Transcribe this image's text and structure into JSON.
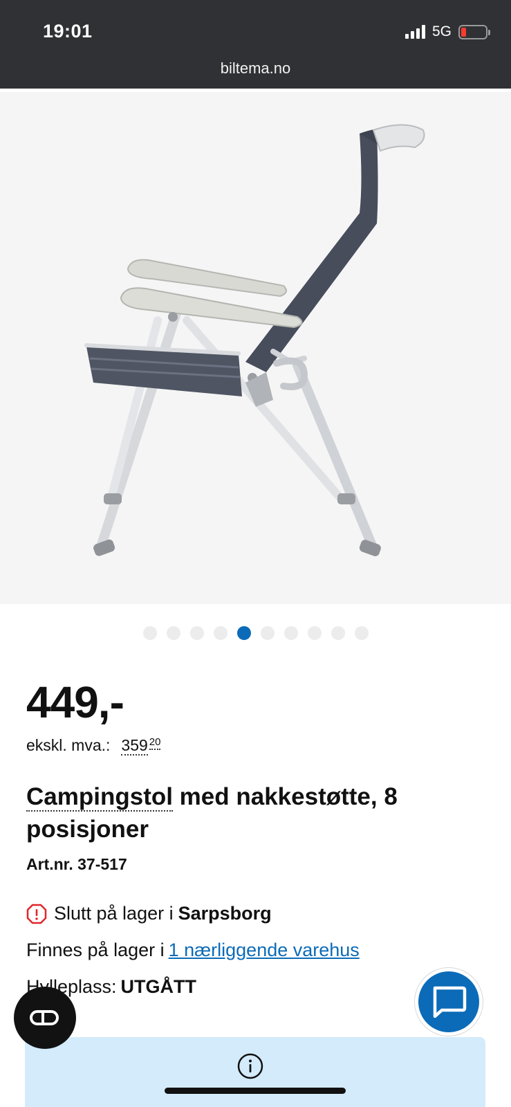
{
  "status_bar": {
    "time": "19:01",
    "network": "5G",
    "battery_color": "#ff3b30"
  },
  "browser": {
    "url": "biltema.no"
  },
  "gallery": {
    "image_icon": "folding-camping-chair-image",
    "total_images": 10,
    "active_index": 4,
    "active_dot_color": "#0b6bb8"
  },
  "product": {
    "price": "449,-",
    "ex_vat_label": "ekskl. mva.:",
    "ex_vat_whole": "359",
    "ex_vat_cents": "20",
    "title_link": "Campingstol",
    "title_rest": " med nakkestøtte, 8 posisjoner",
    "article_number": "Art.nr. 37-517"
  },
  "stock": {
    "out_of_stock_prefix": "Slutt på lager i",
    "store_name": "Sarpsborg",
    "nearby_prefix": "Finnes på lager i",
    "nearby_link": "1 nærliggende varehus",
    "shelf_label": "Hylleplass:",
    "shelf_value": "UTGÅTT",
    "warning_color": "#e0262b"
  },
  "floating": {
    "cobrowse_icon": "cobrowse-icon",
    "chat_icon": "chat-bubble-icon",
    "chat_color": "#0b6bb8"
  },
  "info_box": {
    "icon": "info-icon",
    "background": "#d3ebfb"
  }
}
